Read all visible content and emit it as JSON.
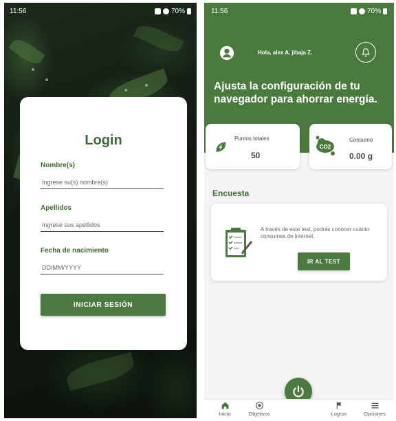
{
  "left_screen": {
    "status_bar": {
      "time": "11:56",
      "battery": "70%"
    },
    "login": {
      "title": "Login",
      "fields": [
        {
          "label": "Nombre(s)",
          "placeholder": "Ingrese su(s) nombre(s)"
        },
        {
          "label": "Apellidos",
          "placeholder": "Ingrese sus apellidos"
        },
        {
          "label": "Fecha de nacimiento",
          "placeholder": "DD/MM/YYYY"
        }
      ],
      "submit_label": "INICIAR SESIÓN"
    }
  },
  "right_screen": {
    "status_bar": {
      "time": "11:56",
      "battery": "70%"
    },
    "header": {
      "greeting": "Hola, alex A. jibaja Z.",
      "headline": "Ajusta la configuración de tu navegador para ahorrar energía."
    },
    "stats": [
      {
        "title": "Puntos totales",
        "value": "50",
        "icon": "leaf-bolt-icon"
      },
      {
        "title": "Consumo",
        "value": "0.00 g",
        "icon": "co2-cloud-icon"
      }
    ],
    "survey": {
      "section_title": "Encuesta",
      "description": "A través de este test, podrás conocer cuánto consumes de internet.",
      "button_label": "IR AL TEST",
      "icon": "clipboard-checklist-icon"
    },
    "bottom_nav": [
      {
        "label": "Inicio",
        "icon": "home-icon"
      },
      {
        "label": "Objetivos",
        "icon": "target-icon"
      },
      {
        "label": "Logros",
        "icon": "flag-icon"
      },
      {
        "label": "Opciones",
        "icon": "menu-icon"
      }
    ],
    "fab_icon": "power-icon",
    "colors": {
      "primary_green": "#4a7a3e",
      "title_green": "#3f6a33",
      "background": "#f4f4f4"
    }
  }
}
